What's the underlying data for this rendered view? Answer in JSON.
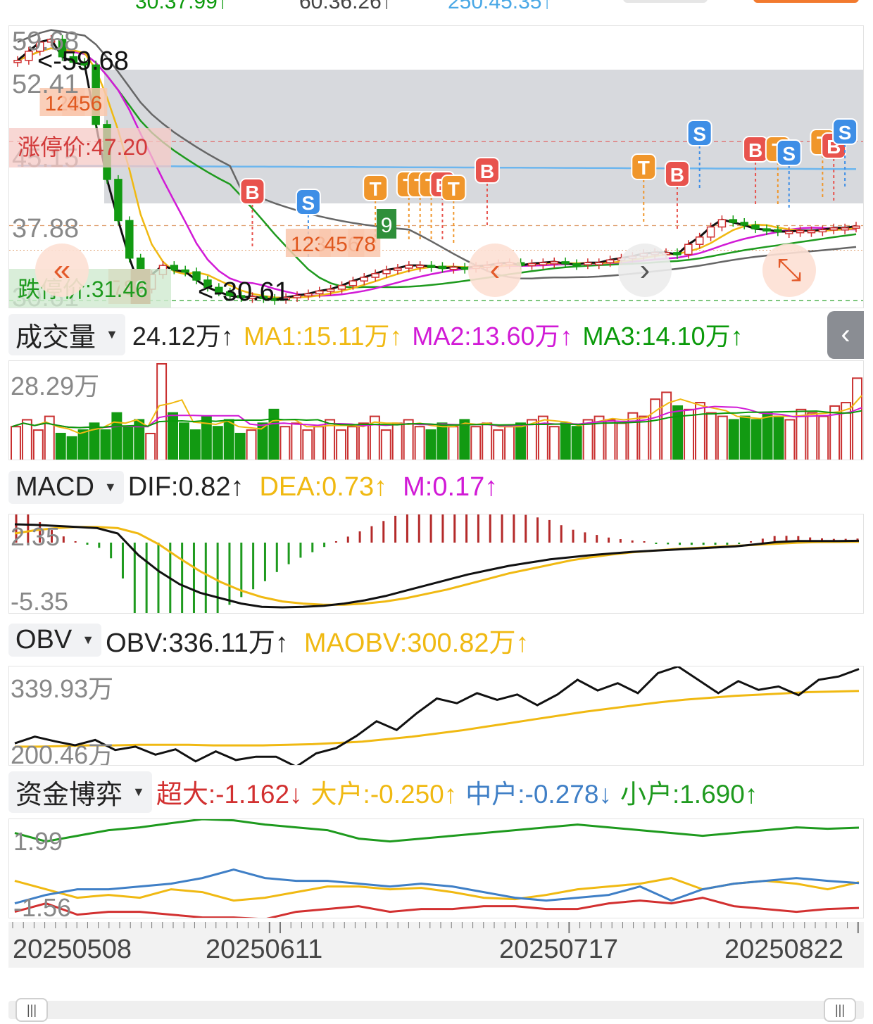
{
  "top_values": {
    "ma_short": "30:37.99↑",
    "ma_mid": "60:36.26↑",
    "ma_long": "250:45.35↑",
    "colors": {
      "ma_short": "#0d9a0d",
      "ma_mid": "#444444",
      "ma_long": "#4aa8e6"
    }
  },
  "price_chart": {
    "axis_labels": [
      "59.68",
      "52.41",
      "45.15",
      "37.88",
      "30.61"
    ],
    "high_label": "<-59.68",
    "low_label": "<-30.61",
    "limit_up_label": "涨停价:47.20",
    "limit_down_label": "跌停价:31.46",
    "ylim": [
      30.61,
      59.68
    ],
    "nav_icons": [
      "double-left-icon",
      "left-icon",
      "right-icon",
      "expand-icon"
    ],
    "signals": [
      {
        "type": "B",
        "x_index": 21,
        "color": "#e8534d"
      },
      {
        "type": "S",
        "x_index": 26,
        "color": "#3d8ee6"
      },
      {
        "type": "T",
        "x_index": 32,
        "color": "#f0962b"
      },
      {
        "type": "T",
        "x_index": 35,
        "color": "#f0962b"
      },
      {
        "type": "T",
        "x_index": 36,
        "color": "#f0962b"
      },
      {
        "type": "T",
        "x_index": 37,
        "color": "#f0962b"
      },
      {
        "type": "B",
        "x_index": 38,
        "color": "#e8534d"
      },
      {
        "type": "T",
        "x_index": 39,
        "color": "#f0962b"
      },
      {
        "type": "B",
        "x_index": 42,
        "color": "#e8534d"
      },
      {
        "type": "T",
        "x_index": 56,
        "color": "#f0962b"
      },
      {
        "type": "B",
        "x_index": 59,
        "color": "#e8534d"
      },
      {
        "type": "S",
        "x_index": 61,
        "color": "#3d8ee6"
      },
      {
        "type": "B",
        "x_index": 66,
        "color": "#e8534d"
      },
      {
        "type": "T",
        "x_index": 68,
        "color": "#f0962b"
      },
      {
        "type": "S",
        "x_index": 69,
        "color": "#3d8ee6"
      },
      {
        "type": "T",
        "x_index": 72,
        "color": "#f0962b"
      },
      {
        "type": "B",
        "x_index": 73,
        "color": "#e8534d"
      },
      {
        "type": "S",
        "x_index": 74,
        "color": "#3d8ee6"
      }
    ],
    "sequence_labels": [
      {
        "text": "123",
        "x_index": 4
      },
      {
        "text": "456",
        "x_index": 6
      },
      {
        "text": "7",
        "x_index": 9
      },
      {
        "text": "8",
        "x_index": 10
      },
      {
        "text": "9",
        "x_index": 11
      },
      {
        "text": "123",
        "x_index": 26
      },
      {
        "text": "456",
        "x_index": 29
      },
      {
        "text": "78",
        "x_index": 31
      },
      {
        "text": "9",
        "x_index": 33
      }
    ]
  },
  "volume": {
    "selector": "成交量",
    "values_label": "24.12万↑",
    "ma1": "MA1:15.11万↑",
    "ma2": "MA2:13.60万↑",
    "ma3": "MA3:14.10万↑",
    "axis_top": "28.29万",
    "colors": {
      "ma1": "#f0b912",
      "ma2": "#d11ad6",
      "ma3": "#0a9a0a"
    }
  },
  "macd": {
    "selector": "MACD",
    "dif": "DIF:0.82↑",
    "dea": "DEA:0.73↑",
    "m": "M:0.17↑",
    "axis_top": "2.35",
    "axis_bottom": "-5.35",
    "ylim": [
      -5.35,
      2.35
    ],
    "colors": {
      "dea": "#f0b912",
      "m": "#d11ad6"
    }
  },
  "obv": {
    "selector": "OBV",
    "obv": "OBV:336.11万↑",
    "maobv": "MAOBV:300.82万↑",
    "axis_top": "339.93万",
    "axis_bottom": "200.46万",
    "ylim": [
      200.46,
      339.93
    ],
    "colors": {
      "maobv": "#f0b912"
    }
  },
  "capital": {
    "selector": "资金博弈",
    "super": "超大:-1.162↓",
    "large": "大户:-0.250↑",
    "mid": "中户:-0.278↓",
    "small": "小户:1.690↑",
    "axis_top": "1.99",
    "axis_bottom": "-1.56",
    "ylim": [
      -1.56,
      1.99
    ],
    "colors": {
      "super": "#d23030",
      "large": "#f0b912",
      "mid": "#3f7fc6",
      "small": "#1e9a1e"
    }
  },
  "dates": [
    "20250508",
    "20250611",
    "20250717",
    "20250822"
  ],
  "chart_data": [
    {
      "type": "line",
      "title": "Candlestick price",
      "ylim": [
        30.61,
        59.68
      ],
      "series": [
        {
          "name": "close",
          "values": [
            57,
            58,
            59,
            59.3,
            57.4,
            56.8,
            56.5,
            50,
            44,
            39.5,
            35.4,
            32,
            33.6,
            34.6,
            34.1,
            33.9,
            33,
            32.2,
            31.7,
            31.3,
            31.1,
            31.2,
            31,
            30.9,
            31.1,
            31.3,
            31.5,
            31.8,
            32,
            32.4,
            32.9,
            33.3,
            33.7,
            34.1,
            34.3,
            34.6,
            34.6,
            34.5,
            34.3,
            34.4,
            34.3,
            34.5,
            34.6,
            34.8,
            34.9,
            34.6,
            34.8,
            34.9,
            35,
            34.8,
            34.7,
            34.9,
            34.9,
            35.2,
            35.4,
            35.6,
            35.9,
            36,
            36,
            35.8,
            36.9,
            37.7,
            38.8,
            39.6,
            39.3,
            39,
            38.6,
            38.5,
            38.3,
            38.3,
            38.4,
            38.4,
            38.5,
            38.7,
            38.7,
            38.9
          ]
        }
      ]
    },
    {
      "type": "bar",
      "title": "Volume",
      "values": [
        10,
        12,
        9,
        13,
        8,
        7,
        9,
        11,
        9,
        14,
        10,
        12,
        8,
        28.29,
        14,
        11,
        9,
        13,
        10,
        12,
        8,
        9,
        11,
        15,
        10,
        11,
        9,
        10,
        12,
        9,
        10,
        11,
        13,
        9,
        11,
        12,
        10,
        9,
        11,
        10,
        12,
        10,
        11,
        9,
        10,
        11,
        12,
        13,
        10,
        11,
        10,
        12,
        13,
        12,
        11,
        14,
        13,
        18,
        20,
        16,
        15,
        17,
        14,
        13,
        12,
        13,
        12,
        14,
        13,
        12,
        15,
        14,
        13,
        16,
        17,
        24.12
      ],
      "ylim": [
        0,
        28.29
      ]
    },
    {
      "type": "line",
      "title": "MACD",
      "ylim": [
        -5.35,
        2.35
      ],
      "series": [
        {
          "name": "DIF",
          "values": [
            2.35,
            2.3,
            2.2,
            2.1,
            2.0,
            1.5,
            -0.5,
            -2,
            -3.2,
            -4,
            -4.5,
            -5,
            -5.3,
            -5.35,
            -5.3,
            -5.2,
            -5.0,
            -4.7,
            -4.3,
            -3.8,
            -3.3,
            -2.8,
            -2.3,
            -1.9,
            -1.5,
            -1.2,
            -0.9,
            -0.7,
            -0.5,
            -0.35,
            -0.2,
            -0.1,
            0,
            0.1,
            0.2,
            0.3,
            0.5,
            0.7,
            0.8,
            0.8,
            0.8,
            0.82
          ]
        },
        {
          "name": "DEA",
          "values": [
            1.5,
            1.8,
            2.0,
            2.1,
            2.1,
            2.0,
            1.5,
            0.5,
            -0.8,
            -2,
            -3,
            -3.8,
            -4.4,
            -4.8,
            -5.0,
            -5.1,
            -5.1,
            -5.0,
            -4.8,
            -4.5,
            -4.1,
            -3.7,
            -3.2,
            -2.7,
            -2.2,
            -1.8,
            -1.4,
            -1.0,
            -0.7,
            -0.45,
            -0.25,
            -0.1,
            0.05,
            0.15,
            0.25,
            0.35,
            0.45,
            0.55,
            0.65,
            0.7,
            0.72,
            0.73
          ]
        }
      ]
    },
    {
      "type": "line",
      "title": "OBV",
      "ylim": [
        200.46,
        339.93
      ],
      "series": [
        {
          "name": "OBV",
          "values": [
            225,
            235,
            228,
            222,
            230,
            215,
            220,
            208,
            216,
            198,
            213,
            200,
            205,
            205,
            190,
            210,
            218,
            236,
            258,
            245,
            270,
            292,
            285,
            300,
            290,
            298,
            282,
            298,
            320,
            304,
            315,
            300,
            330,
            339.93,
            320,
            300,
            318,
            305,
            310,
            297,
            320,
            325,
            336.11
          ]
        },
        {
          "name": "MAOBV",
          "values": [
            212,
            212,
            213,
            214,
            214,
            215,
            215,
            215,
            214,
            214,
            214,
            215,
            216,
            218,
            220,
            224,
            228,
            233,
            238,
            244,
            250,
            256,
            262,
            268,
            273,
            278,
            283,
            287,
            290,
            293,
            295,
            297,
            299,
            300,
            300.82
          ]
        }
      ]
    },
    {
      "type": "line",
      "title": "资金博弈",
      "ylim": [
        -1.56,
        1.99
      ],
      "series": [
        {
          "name": "超大",
          "values": [
            -1.3,
            -1.0,
            -1.4,
            -1.3,
            -1.3,
            -1.4,
            -1.5,
            -1.5,
            -1.56,
            -1.3,
            -1.2,
            -1.1,
            -1.3,
            -1.2,
            -1.2,
            -1.1,
            -1.1,
            -1.2,
            -1.2,
            -1.0,
            -0.9,
            -1.0,
            -0.8,
            -1.1,
            -1.2,
            -1.3,
            -1.2,
            -1.162
          ]
        },
        {
          "name": "大户",
          "values": [
            -0.2,
            -0.5,
            -0.8,
            -0.7,
            -0.8,
            -0.5,
            -0.6,
            -0.9,
            -0.8,
            -0.6,
            -0.4,
            -0.4,
            -0.5,
            -0.45,
            -0.6,
            -0.8,
            -0.85,
            -0.7,
            -0.5,
            -0.4,
            -0.3,
            -0.1,
            -0.5,
            -0.3,
            -0.2,
            -0.3,
            -0.5,
            -0.25
          ]
        },
        {
          "name": "中户",
          "values": [
            -1.0,
            -0.7,
            -0.5,
            -0.5,
            -0.4,
            -0.3,
            -0.1,
            0.2,
            -0.1,
            -0.2,
            -0.2,
            -0.3,
            -0.4,
            -0.3,
            -0.4,
            -0.6,
            -0.8,
            -0.9,
            -0.8,
            -0.7,
            -0.4,
            -0.9,
            -0.5,
            -0.3,
            -0.2,
            -0.1,
            -0.2,
            -0.278
          ]
        },
        {
          "name": "小户",
          "values": [
            1.5,
            1.2,
            1.4,
            1.6,
            1.7,
            1.85,
            1.99,
            1.95,
            1.8,
            1.7,
            1.6,
            1.3,
            1.2,
            1.3,
            1.4,
            1.5,
            1.6,
            1.7,
            1.8,
            1.7,
            1.6,
            1.5,
            1.4,
            1.5,
            1.6,
            1.7,
            1.65,
            1.69
          ]
        }
      ]
    }
  ]
}
